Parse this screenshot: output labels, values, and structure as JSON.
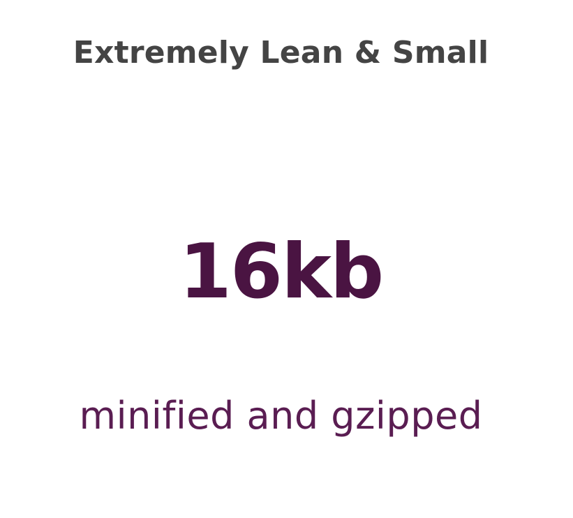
{
  "feature": {
    "heading": "Extremely Lean & Small",
    "stat_value": "16kb",
    "stat_caption": "minified and gzipped"
  },
  "colors": {
    "background": "#ffffff",
    "heading": "#444444",
    "stat_value": "#4a1442",
    "stat_caption": "#5a1d52"
  }
}
